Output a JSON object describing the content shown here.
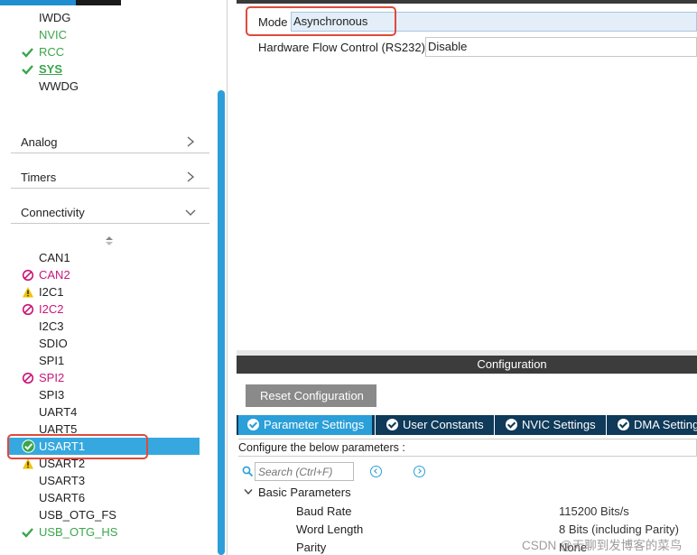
{
  "left_panel": {
    "system_core_items": [
      {
        "label": "IWDG",
        "checked": false,
        "color": "default"
      },
      {
        "label": "NVIC",
        "checked": false,
        "color": "green"
      },
      {
        "label": "RCC",
        "checked": true,
        "color": "green"
      },
      {
        "label": "SYS",
        "checked": true,
        "color": "green-bold"
      },
      {
        "label": "WWDG",
        "checked": false,
        "color": "default"
      }
    ],
    "sections": [
      {
        "label": "Analog",
        "expanded": false
      },
      {
        "label": "Timers",
        "expanded": false
      },
      {
        "label": "Connectivity",
        "expanded": true
      }
    ],
    "connectivity_items": [
      {
        "label": "CAN1",
        "status": "none"
      },
      {
        "label": "CAN2",
        "status": "blocked"
      },
      {
        "label": "I2C1",
        "status": "warning"
      },
      {
        "label": "I2C2",
        "status": "blocked"
      },
      {
        "label": "I2C3",
        "status": "none"
      },
      {
        "label": "SDIO",
        "status": "none"
      },
      {
        "label": "SPI1",
        "status": "none"
      },
      {
        "label": "SPI2",
        "status": "blocked"
      },
      {
        "label": "SPI3",
        "status": "none"
      },
      {
        "label": "UART4",
        "status": "none"
      },
      {
        "label": "UART5",
        "status": "none"
      },
      {
        "label": "USART1",
        "status": "enabled-selected"
      },
      {
        "label": "USART2",
        "status": "warning"
      },
      {
        "label": "USART3",
        "status": "none"
      },
      {
        "label": "USART6",
        "status": "none"
      },
      {
        "label": "USB_OTG_FS",
        "status": "none"
      },
      {
        "label": "USB_OTG_HS",
        "status": "checked"
      }
    ]
  },
  "mode_panel": {
    "mode_label": "Mode",
    "mode_value": "Asynchronous",
    "flow_label": "Hardware Flow Control (RS232)",
    "flow_value": "Disable"
  },
  "config_panel": {
    "title": "Configuration",
    "reset_button": "Reset Configuration",
    "tabs": [
      {
        "label": "Parameter Settings",
        "active": true
      },
      {
        "label": "User Constants",
        "active": false
      },
      {
        "label": "NVIC Settings",
        "active": false
      },
      {
        "label": "DMA Settings",
        "active": false
      }
    ],
    "hint": "Configure the below parameters :",
    "search_placeholder": "Search (Ctrl+F)",
    "group_label": "Basic Parameters",
    "params": [
      {
        "name": "Baud Rate",
        "value": "115200 Bits/s"
      },
      {
        "name": "Word Length",
        "value": "8 Bits (including Parity)"
      },
      {
        "name": "Parity",
        "value": "None"
      }
    ]
  },
  "watermark": "CSDN @无聊到发博客的菜鸟",
  "colors": {
    "accent": "#2a9fd8",
    "selected_row": "#36a8df",
    "enabled_green": "#3aa64a",
    "blocked_magenta": "#c8177a",
    "warning_yellow": "#f2c200",
    "highlight_red": "#e04a3b",
    "tab_bar": "#0f3a5a"
  }
}
